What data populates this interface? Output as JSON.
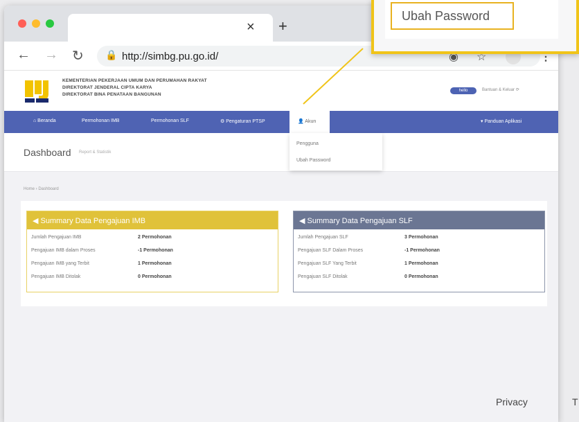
{
  "browser": {
    "url": "http://simbg.pu.go.id/",
    "tab_close_glyph": "×",
    "new_tab_glyph": "+"
  },
  "header": {
    "ministry_lines": [
      "KEMENTERIAN PEKERJAAN UMUM DAN PERUMAHAN RAKYAT",
      "DIREKTORAT JENDERAL CIPTA KARYA",
      "DIREKTORAT BINA PENATAAN BANGUNAN"
    ],
    "user_badge": "hello",
    "user_meta": "Bantuan & Keluar ⟳"
  },
  "nav": {
    "items": [
      "⌂ Beranda",
      "Permohonan IMB",
      "Permohonan SLF",
      "⚙ Pengaturan PTSP"
    ],
    "account": "👤 Akun",
    "guide": "▾ Panduan Aplikasi"
  },
  "dropdown": {
    "items": [
      "Pengguna",
      "Ubah Password"
    ]
  },
  "dashboard": {
    "title": "Dashboard",
    "subtitle": "Report & Statistik",
    "breadcrumb": "Home › Dashboard"
  },
  "summary_imb": {
    "title": "◀ Summary Data Pengajuan IMB",
    "rows": [
      {
        "label": "Jumlah Pengajuan IMB",
        "value": "2 Permohonan"
      },
      {
        "label": "Pengajuan IMB dalam Proses",
        "value": "-1 Permohonan"
      },
      {
        "label": "Pengajuan IMB yang Terbit",
        "value": "1 Permohonan"
      },
      {
        "label": "Pengajuan IMB Ditolak",
        "value": "0 Permohonan"
      }
    ]
  },
  "summary_slf": {
    "title": "◀ Summary Data Pengajuan SLF",
    "rows": [
      {
        "label": "Jumlah Pengajuan SLF",
        "value": "3 Permohonan"
      },
      {
        "label": "Pengajuan SLF Dalam Proses",
        "value": "-1 Permohonan"
      },
      {
        "label": "Pengajuan SLF Yang Terbit",
        "value": "1 Permohonan"
      },
      {
        "label": "Pengajuan SLF Ditolak",
        "value": "0 Permohonan"
      }
    ]
  },
  "footer": {
    "privacy": "Privacy",
    "cut_letter": "T"
  },
  "callout": {
    "label": "Ubah Password"
  },
  "colors": {
    "navbar": "#4f63b3",
    "imb_header": "#e0c23a",
    "slf_header": "#6b7693",
    "callout_border": "#f0c419"
  }
}
